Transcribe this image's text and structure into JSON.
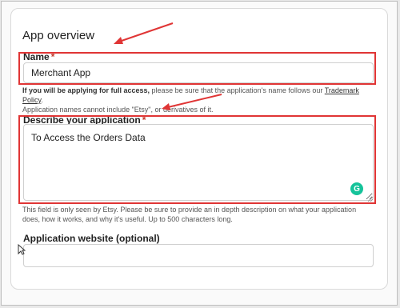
{
  "section": {
    "title": "App overview"
  },
  "name_field": {
    "label": "Name",
    "required_mark": "*",
    "value": "Merchant App"
  },
  "name_help": {
    "bold_text": "If you will be applying for full access,",
    "text_before_link": " please be sure that the application's name follows our ",
    "link_text": "Trademark Policy",
    "text_after_link": ".",
    "line2": "Application names cannot include \"Etsy\", or derivatives of it."
  },
  "description_field": {
    "label": "Describe your application",
    "required_mark": "*",
    "value": "To Access the Orders Data"
  },
  "description_help": {
    "text": "This field is only seen by Etsy. Please be sure to provide an in depth description on what your application does, how it works, and why it's useful. Up to 500 characters long."
  },
  "website_field": {
    "label": "Application website (optional)",
    "value": ""
  },
  "icons": {
    "grammarly": "grammarly-icon",
    "annotation_arrow": "red-arrow",
    "cursor": "mouse-pointer"
  },
  "colors": {
    "highlight": "#e03535",
    "required": "#c0392b",
    "grammarly": "#15c39a"
  }
}
